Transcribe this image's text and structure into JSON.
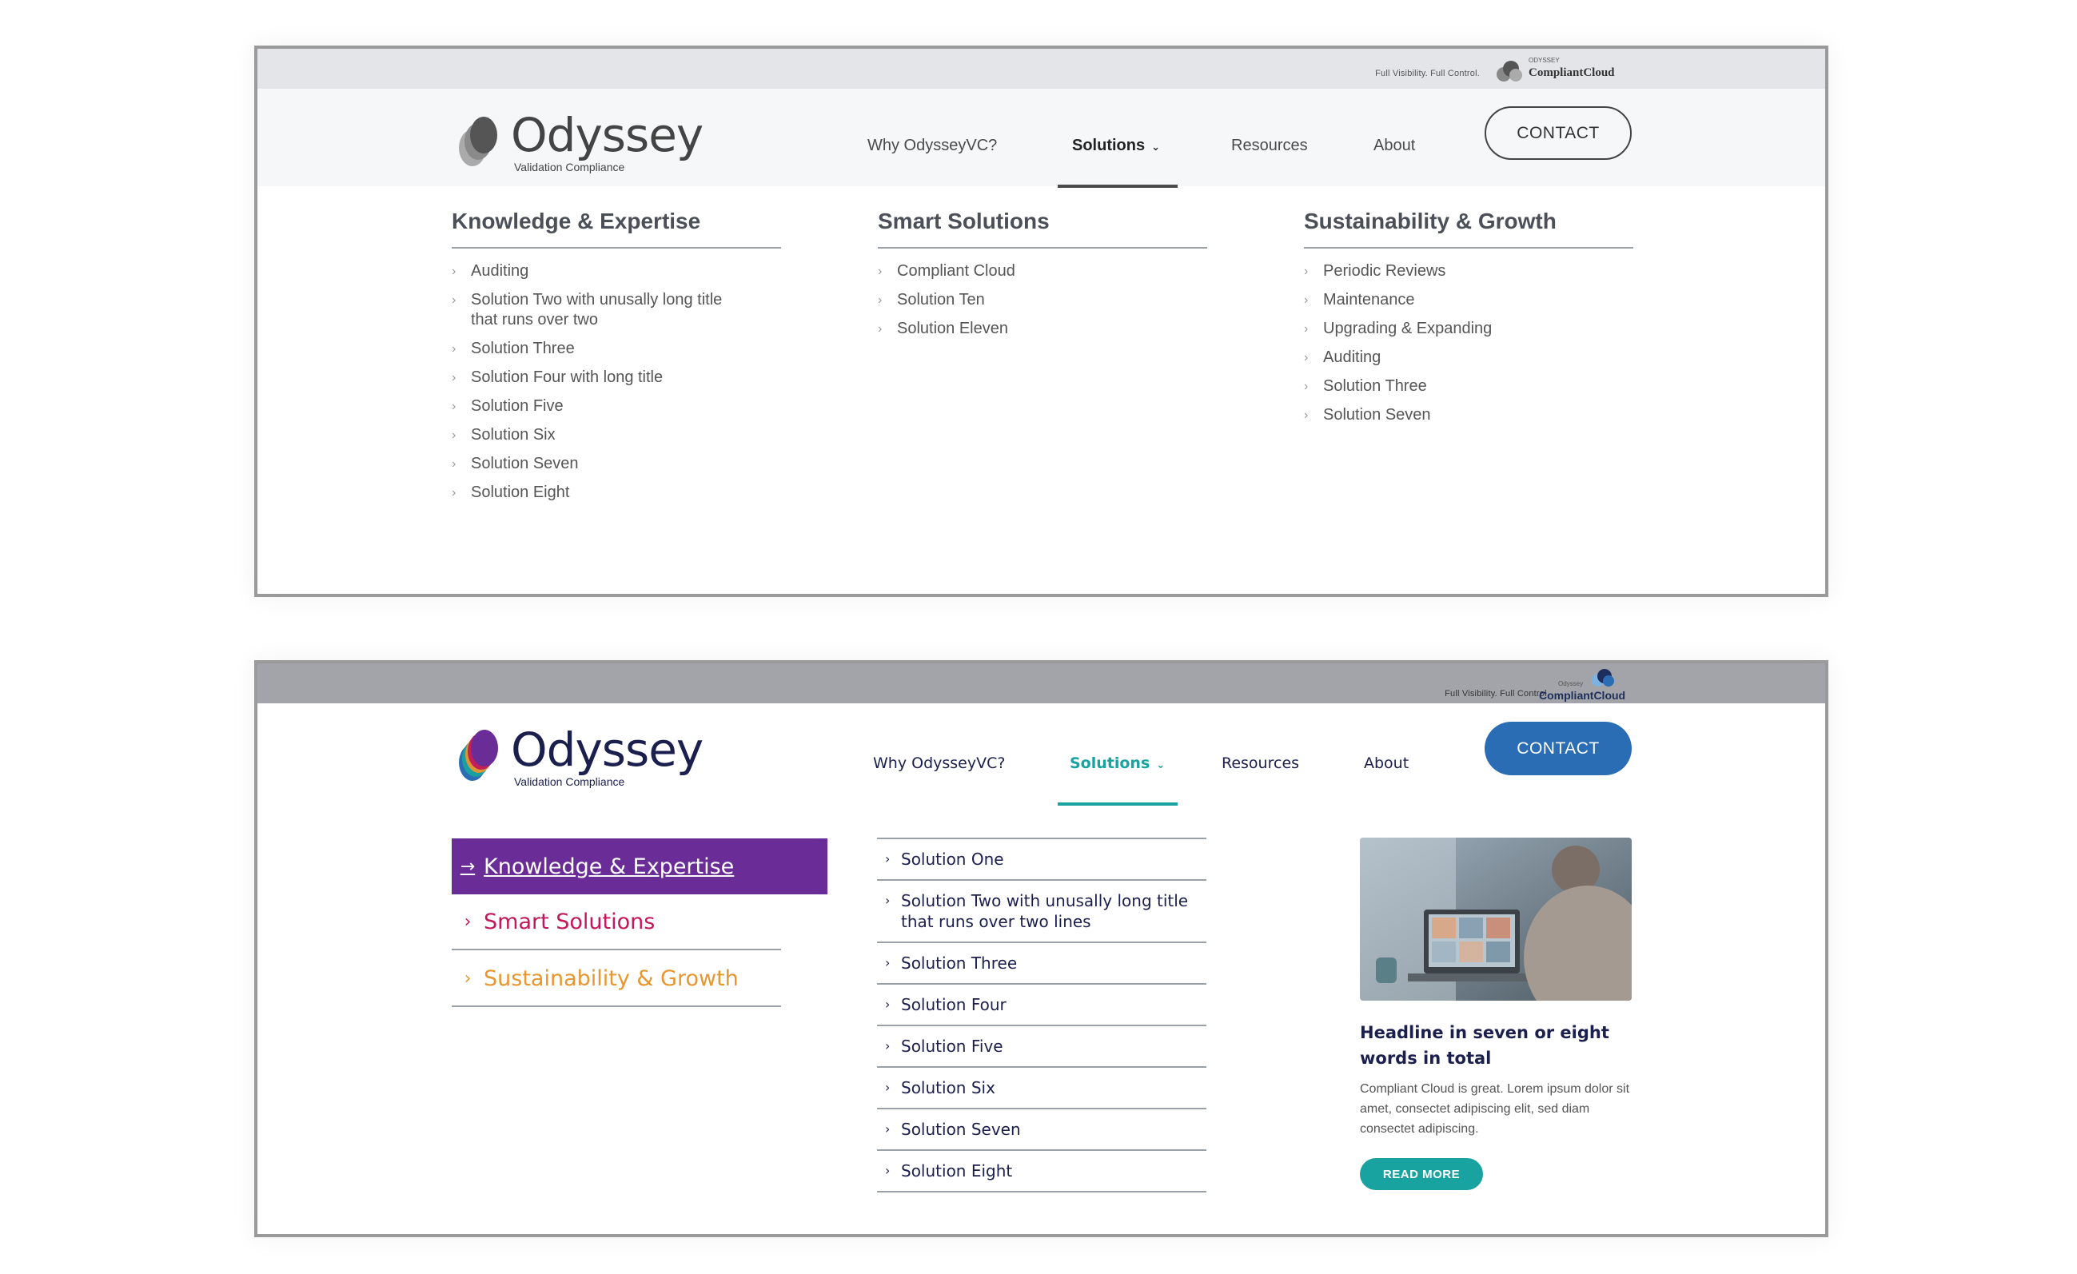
{
  "variant_gray": {
    "topbar": {
      "tagline": "Full Visibility. Full Control.",
      "cc_small": "ODYSSEY",
      "cc_name": "CompliantCloud"
    },
    "logo": {
      "word": "Odyssey",
      "sub": "Validation Compliance"
    },
    "nav": {
      "why": "Why OdysseyVC?",
      "solutions": "Solutions",
      "resources": "Resources",
      "about": "About",
      "contact": "CONTACT"
    },
    "columns": [
      {
        "title": "Knowledge & Expertise",
        "items": [
          "Auditing",
          "Solution Two with unusally long title that runs over two",
          "Solution Three",
          "Solution Four with long title",
          "Solution Five",
          "Solution Six",
          "Solution Seven",
          "Solution Eight"
        ]
      },
      {
        "title": "Smart Solutions",
        "items": [
          "Compliant Cloud",
          "Solution Ten",
          "Solution Eleven"
        ]
      },
      {
        "title": "Sustainability & Growth",
        "items": [
          "Periodic Reviews",
          "Maintenance",
          "Upgrading & Expanding",
          "Auditing",
          "Solution Three",
          "Solution Seven"
        ]
      }
    ]
  },
  "variant_color": {
    "topbar": {
      "tagline": "Full Visibility. Full Control.",
      "cc_small": "Odyssey",
      "cc_name": "CompliantCloud"
    },
    "logo": {
      "word": "Odyssey",
      "sub": "Validation Compliance"
    },
    "nav": {
      "why": "Why OdysseyVC?",
      "solutions": "Solutions",
      "resources": "Resources",
      "about": "About",
      "contact": "CONTACT"
    },
    "categories": [
      {
        "label": "Knowledge & Expertise",
        "color": "#6a2c96",
        "active": true
      },
      {
        "label": "Smart Solutions",
        "color": "#c2185b"
      },
      {
        "label": "Sustainability & Growth",
        "color": "#e8962e"
      }
    ],
    "items": [
      "Solution One",
      "Solution Two with unusally long title that runs over two lines",
      "Solution Three",
      "Solution Four",
      "Solution Five",
      "Solution Six",
      "Solution Seven",
      "Solution Eight"
    ],
    "promo": {
      "headline": "Headline in seven or eight words in total",
      "text": "Compliant Cloud is great. Lorem ipsum dolor sit amet, consectet adipiscing elit, sed diam consectet adipiscing.",
      "button": "READ MORE"
    }
  },
  "colors": {
    "teal": "#19a3a0",
    "navy": "#1b1f4d",
    "blue": "#2b6db5",
    "purple": "#6a2c96",
    "magenta": "#c2185b",
    "orange": "#e8962e"
  }
}
